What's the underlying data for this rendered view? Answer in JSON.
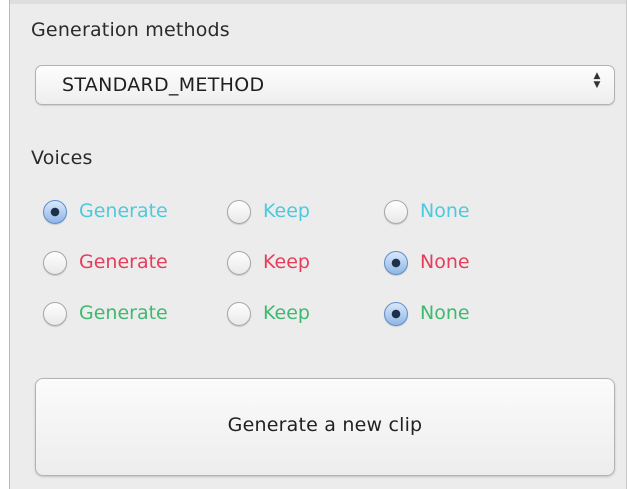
{
  "generation_methods": {
    "label": "Generation methods",
    "selected": "STANDARD_METHOD",
    "arrows_icon": "up-down-chevrons-icon"
  },
  "voices": {
    "label": "Voices",
    "rows": [
      {
        "color": "#4ec9dc",
        "selected": "Generate",
        "options": [
          {
            "label": "Generate",
            "checked": true
          },
          {
            "label": "Keep",
            "checked": false
          },
          {
            "label": "None",
            "checked": false
          }
        ]
      },
      {
        "color": "#e63d5a",
        "selected": "None",
        "options": [
          {
            "label": "Generate",
            "checked": false
          },
          {
            "label": "Keep",
            "checked": false
          },
          {
            "label": "None",
            "checked": true
          }
        ]
      },
      {
        "color": "#3fb870",
        "selected": "None",
        "options": [
          {
            "label": "Generate",
            "checked": false
          },
          {
            "label": "Keep",
            "checked": false
          },
          {
            "label": "None",
            "checked": true
          }
        ]
      }
    ]
  },
  "generate_button": {
    "label": "Generate a new clip"
  }
}
